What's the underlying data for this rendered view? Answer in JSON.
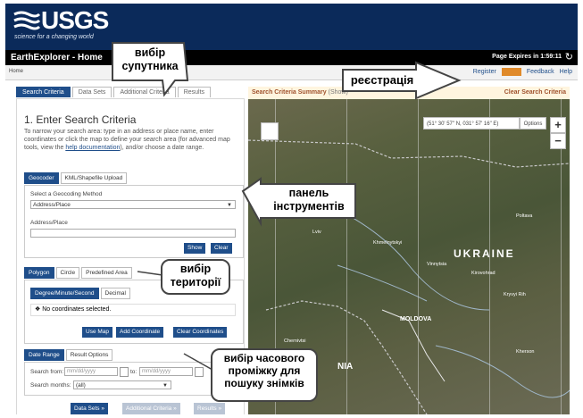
{
  "banner": {
    "logo_text": "USGS",
    "tagline": "science for a changing world"
  },
  "titlebar": {
    "app_title": "EarthExplorer - Home",
    "expires": "Page Expires in 1:59:11",
    "refresh_icon": "refresh-icon"
  },
  "navbar": {
    "crumb": "Home",
    "register": "Register",
    "feedback": "Feedback",
    "help": "Help"
  },
  "tabs": [
    "Search Criteria",
    "Data Sets",
    "Additional Criteria",
    "Results"
  ],
  "criteria": {
    "heading": "1. Enter Search Criteria",
    "help_pre": "To narrow your search area: type in an address or place name, enter coordinates or click the map to define your search area (for advanced map tools, view the ",
    "help_link": "help documentation",
    "help_post": "), and/or choose a date range."
  },
  "geocoder": {
    "tabs": [
      "Geocoder",
      "KML/Shapefile Upload"
    ],
    "method_label": "Select a Geocoding Method",
    "method_value": "Address/Place",
    "address_label": "Address/Place",
    "show": "Show",
    "clear": "Clear"
  },
  "area": {
    "tabs": [
      "Polygon",
      "Circle",
      "Predefined Area"
    ],
    "format_tabs": [
      "Degree/Minute/Second",
      "Decimal"
    ],
    "no_coords": "No coordinates selected.",
    "use_map": "Use Map",
    "add_coordinate": "Add Coordinate",
    "clear_coordinates": "Clear Coordinates"
  },
  "date": {
    "tabs": [
      "Date Range",
      "Result Options"
    ],
    "search_from_label": "Search from:",
    "from_placeholder": "mm/dd/yyyy",
    "to_label": "to:",
    "to_placeholder": "mm/dd/yyyy",
    "months_label": "Search months:",
    "months_value": "(all)"
  },
  "bottom_buttons": [
    "Data Sets »",
    "Additional Criteria »",
    "Results »"
  ],
  "map": {
    "summary_title": "Search Criteria Summary",
    "summary_sub": "(Show)",
    "clear_all": "Clear Search Criteria",
    "coords": "(51° 30' 57\" N, 031° 57' 16\" E)",
    "options": "Options",
    "zoom_in": "+",
    "zoom_out": "−",
    "country": "UKRAINE",
    "moldova": "MOLDOVA",
    "nia": "NIA",
    "cities": [
      {
        "name": "Lviv"
      },
      {
        "name": "Khmelnytskyi"
      },
      {
        "name": "Vinnytsia"
      },
      {
        "name": "Kirovohrad"
      },
      {
        "name": "Kryvyi Rih"
      },
      {
        "name": "Chernivtsi"
      },
      {
        "name": "Kherson"
      },
      {
        "name": "Poltava"
      }
    ]
  },
  "annotations": {
    "satellite": "вибір супутника",
    "register": "реєстрація",
    "toolbar": "панель інструментів",
    "territory": "вибір території",
    "period": "вибір часового проміжку для пошуку знімків"
  },
  "colors": {
    "usgs_blue": "#0b2a5a",
    "tab_blue": "#1f4e8a",
    "accent_orange": "#e08a2a"
  }
}
